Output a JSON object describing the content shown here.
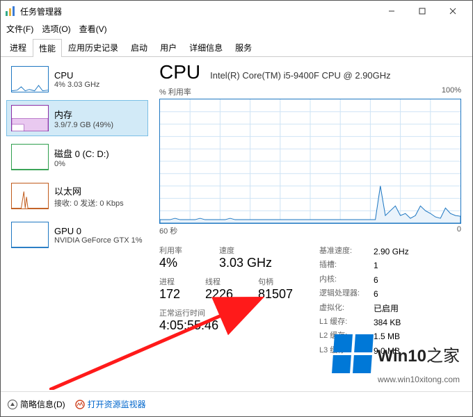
{
  "window": {
    "title": "任务管理器"
  },
  "menu": {
    "file": "文件(F)",
    "options": "选项(O)",
    "view": "查看(V)"
  },
  "tabs": [
    "进程",
    "性能",
    "应用历史记录",
    "启动",
    "用户",
    "详细信息",
    "服务"
  ],
  "activeTab": 1,
  "sidebar": {
    "items": [
      {
        "name": "CPU",
        "sub": "4% 3.03 GHz"
      },
      {
        "name": "内存",
        "sub": "3.9/7.9 GB (49%)"
      },
      {
        "name": "磁盘 0 (C: D:)",
        "sub": "0%"
      },
      {
        "name": "以太网",
        "sub": "接收: 0 发送: 0 Kbps"
      },
      {
        "name": "GPU 0",
        "sub": "NVIDIA GeForce GTX 1%"
      }
    ],
    "selectedIndex": 1
  },
  "main": {
    "title": "CPU",
    "model": "Intel(R) Core(TM) i5-9400F CPU @ 2.90GHz",
    "chart": {
      "yLabel": "% 利用率",
      "yMax": "100%",
      "xLeft": "60 秒",
      "xRight": "0"
    },
    "statsL": {
      "r1": [
        {
          "label": "利用率",
          "value": "4%"
        },
        {
          "label": "速度",
          "value": "3.03 GHz"
        }
      ],
      "r2": [
        {
          "label": "进程",
          "value": "172"
        },
        {
          "label": "线程",
          "value": "2226"
        },
        {
          "label": "句柄",
          "value": "81507"
        }
      ],
      "uptimeLabel": "正常运行时间",
      "uptime": "4:05:55:46"
    },
    "statsR": [
      {
        "k": "基准速度:",
        "v": "2.90 GHz"
      },
      {
        "k": "插槽:",
        "v": "1"
      },
      {
        "k": "内核:",
        "v": "6"
      },
      {
        "k": "逻辑处理器:",
        "v": "6"
      },
      {
        "k": "虚拟化:",
        "v": "已启用"
      },
      {
        "k": "L1 缓存:",
        "v": "384 KB"
      },
      {
        "k": "L2 缓存:",
        "v": "1.5 MB"
      },
      {
        "k": "L3 缓存:",
        "v": "9.0 MB"
      }
    ]
  },
  "footer": {
    "brief": "简略信息(D)",
    "resmon": "打开资源监视器"
  },
  "watermark": {
    "brand1": "Win10",
    "brand2": "之家",
    "url": "www.win10xitong.com"
  },
  "chart_data": {
    "type": "line",
    "title": "CPU % 利用率",
    "xlabel": "秒",
    "ylabel": "% 利用率",
    "x_range_seconds": [
      60,
      0
    ],
    "ylim": [
      0,
      100
    ],
    "series": [
      {
        "name": "CPU",
        "values": [
          3,
          3,
          3,
          4,
          3,
          3,
          3,
          3,
          4,
          3,
          3,
          3,
          3,
          3,
          4,
          3,
          3,
          3,
          3,
          3,
          3,
          3,
          3,
          3,
          3,
          3,
          3,
          3,
          3,
          3,
          3,
          3,
          3,
          3,
          3,
          3,
          3,
          3,
          3,
          3,
          3,
          3,
          3,
          3,
          30,
          6,
          10,
          14,
          6,
          8,
          4,
          6,
          14,
          10,
          8,
          5,
          4,
          12,
          8,
          6
        ]
      }
    ]
  }
}
